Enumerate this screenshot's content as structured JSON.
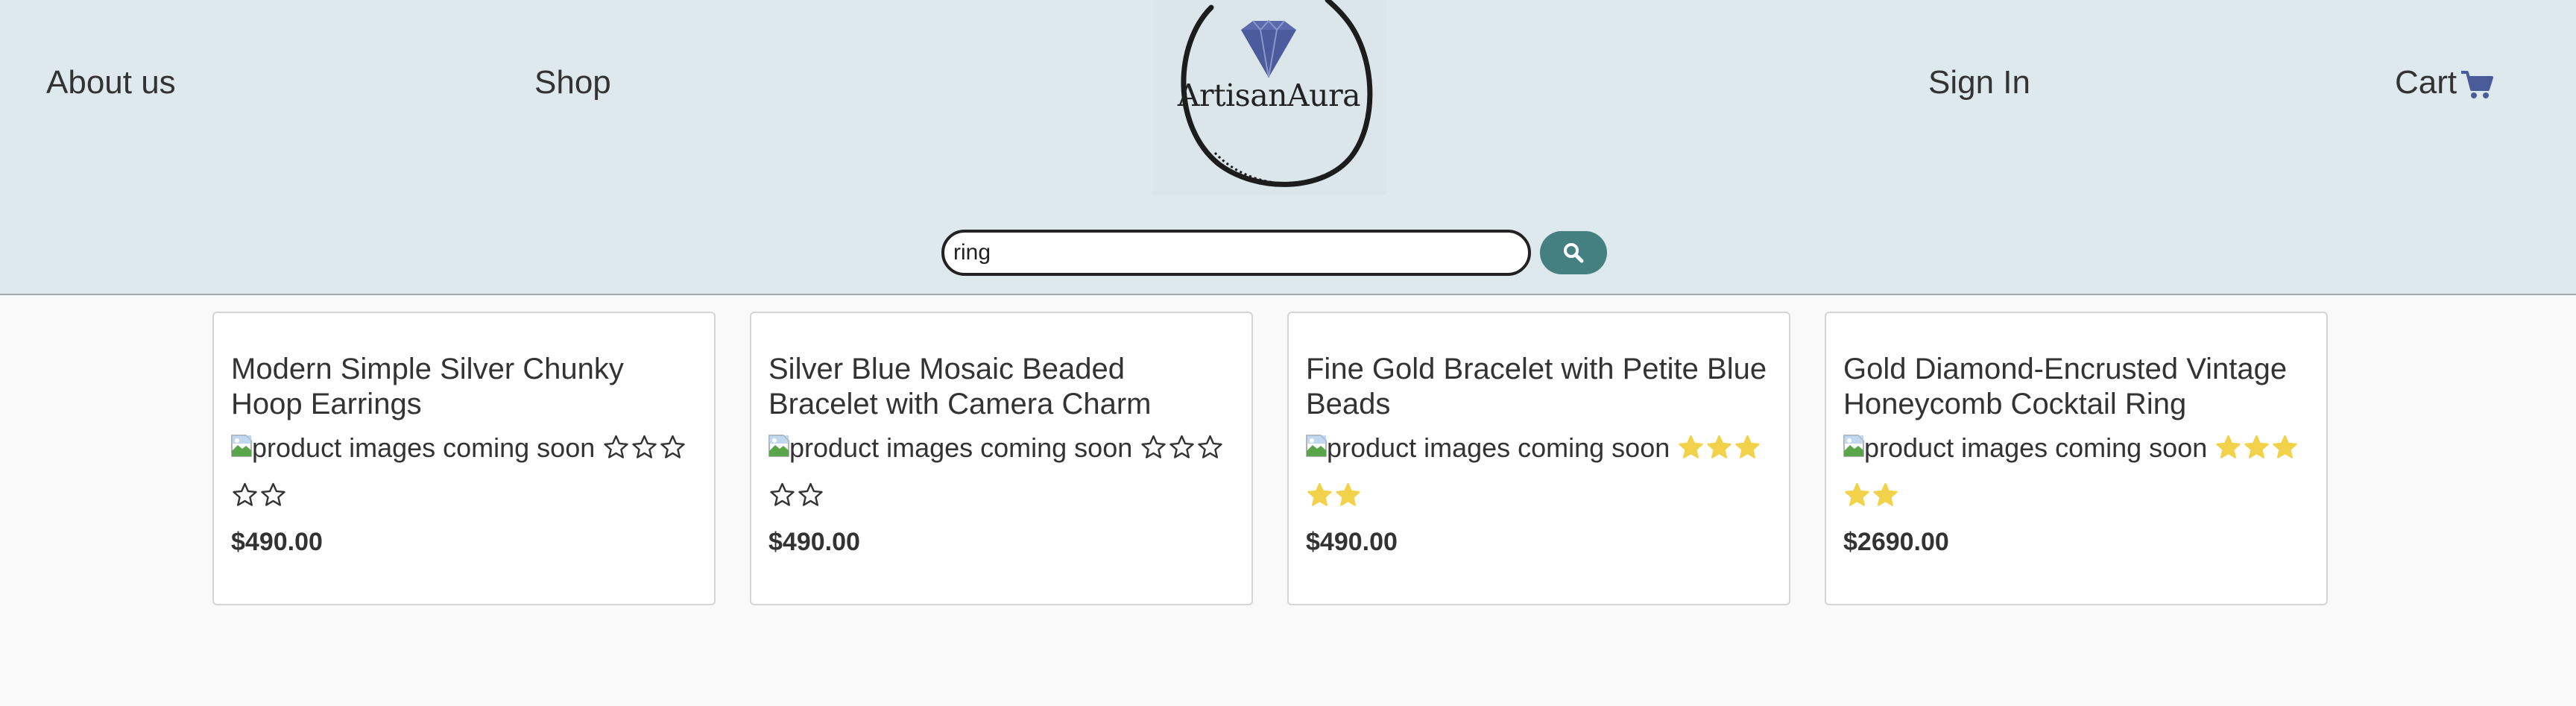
{
  "nav": {
    "about": "About us",
    "shop": "Shop",
    "signin": "Sign In",
    "cart": "Cart"
  },
  "brand": {
    "name": "ArtisanAura",
    "accent": "#5060a0"
  },
  "search": {
    "value": "ring",
    "button_icon": "search-icon"
  },
  "colors": {
    "header_bg": "#dde9ec",
    "search_button": "#44807f",
    "star_filled": "#f2d24b",
    "cart_icon": "#4a5b9a"
  },
  "products": [
    {
      "title": "Modern Simple Silver Chunky Hoop Earrings",
      "image_alt": "product images coming soon",
      "rating": 0,
      "max_rating": 5,
      "price": "$490.00"
    },
    {
      "title": "Silver Blue Mosaic Beaded Bracelet with Camera Charm",
      "image_alt": "product images coming soon",
      "rating": 0,
      "max_rating": 5,
      "price": "$490.00"
    },
    {
      "title": "Fine Gold Bracelet with Petite Blue Beads",
      "image_alt": "product images coming soon",
      "rating": 5,
      "max_rating": 5,
      "price": "$490.00"
    },
    {
      "title": "Gold Diamond-Encrusted Vintage Honeycomb Cocktail Ring",
      "image_alt": "product images coming soon",
      "rating": 5,
      "max_rating": 5,
      "price": "$2690.00"
    }
  ]
}
